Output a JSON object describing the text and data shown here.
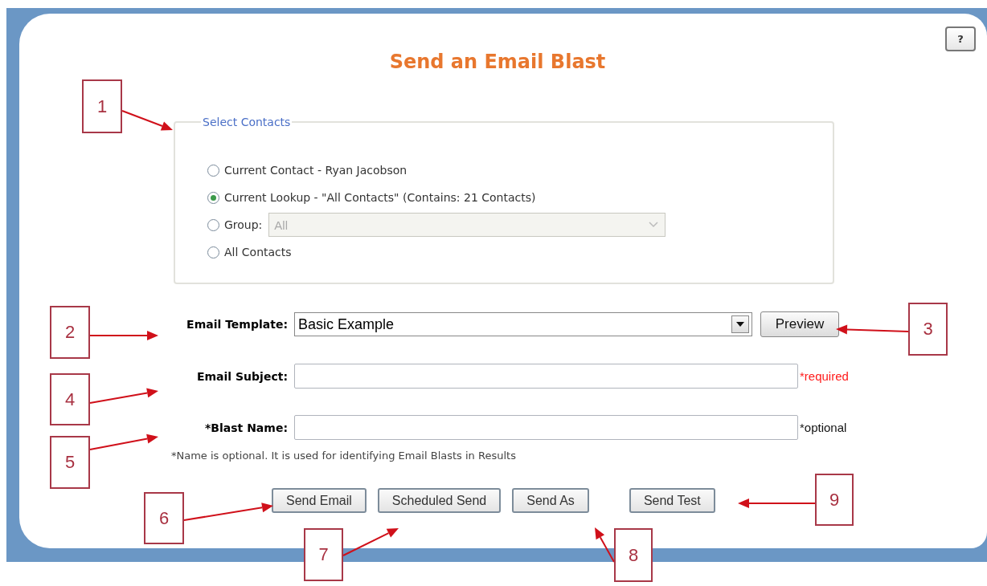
{
  "title": "Send an Email Blast",
  "help_button": "?",
  "select_contacts": {
    "legend": "Select Contacts",
    "options": [
      {
        "kind": "plain",
        "label": "Current Contact - Ryan Jacobson",
        "selected": false
      },
      {
        "kind": "plain",
        "label": "Current Lookup - \"All Contacts\" (Contains: 21 Contacts)",
        "selected": true
      },
      {
        "kind": "dropdown",
        "label": "Group:",
        "selected": false,
        "dropdown": {
          "value": "All",
          "disabled": true
        }
      },
      {
        "kind": "plain",
        "label": "All Contacts",
        "selected": false
      }
    ]
  },
  "fields": [
    {
      "kind": "select",
      "label": "Email Template:",
      "value": "Basic Example",
      "button": "Preview"
    },
    {
      "kind": "text",
      "label": "Email Subject:",
      "note": "*required",
      "required": true
    },
    {
      "kind": "text",
      "label": "*Blast Name:",
      "note": "*optional",
      "required": false
    }
  ],
  "hint": "*Name is optional. It is used for identifying Email Blasts in Results",
  "buttons": [
    "Send Email",
    "Scheduled Send",
    "Send As",
    "Send Test"
  ],
  "callouts": [
    {
      "number": "1"
    },
    {
      "number": "2"
    },
    {
      "number": "3"
    },
    {
      "number": "4"
    },
    {
      "number": "5"
    },
    {
      "number": "6"
    },
    {
      "number": "7"
    },
    {
      "number": "8"
    },
    {
      "number": "9"
    }
  ]
}
